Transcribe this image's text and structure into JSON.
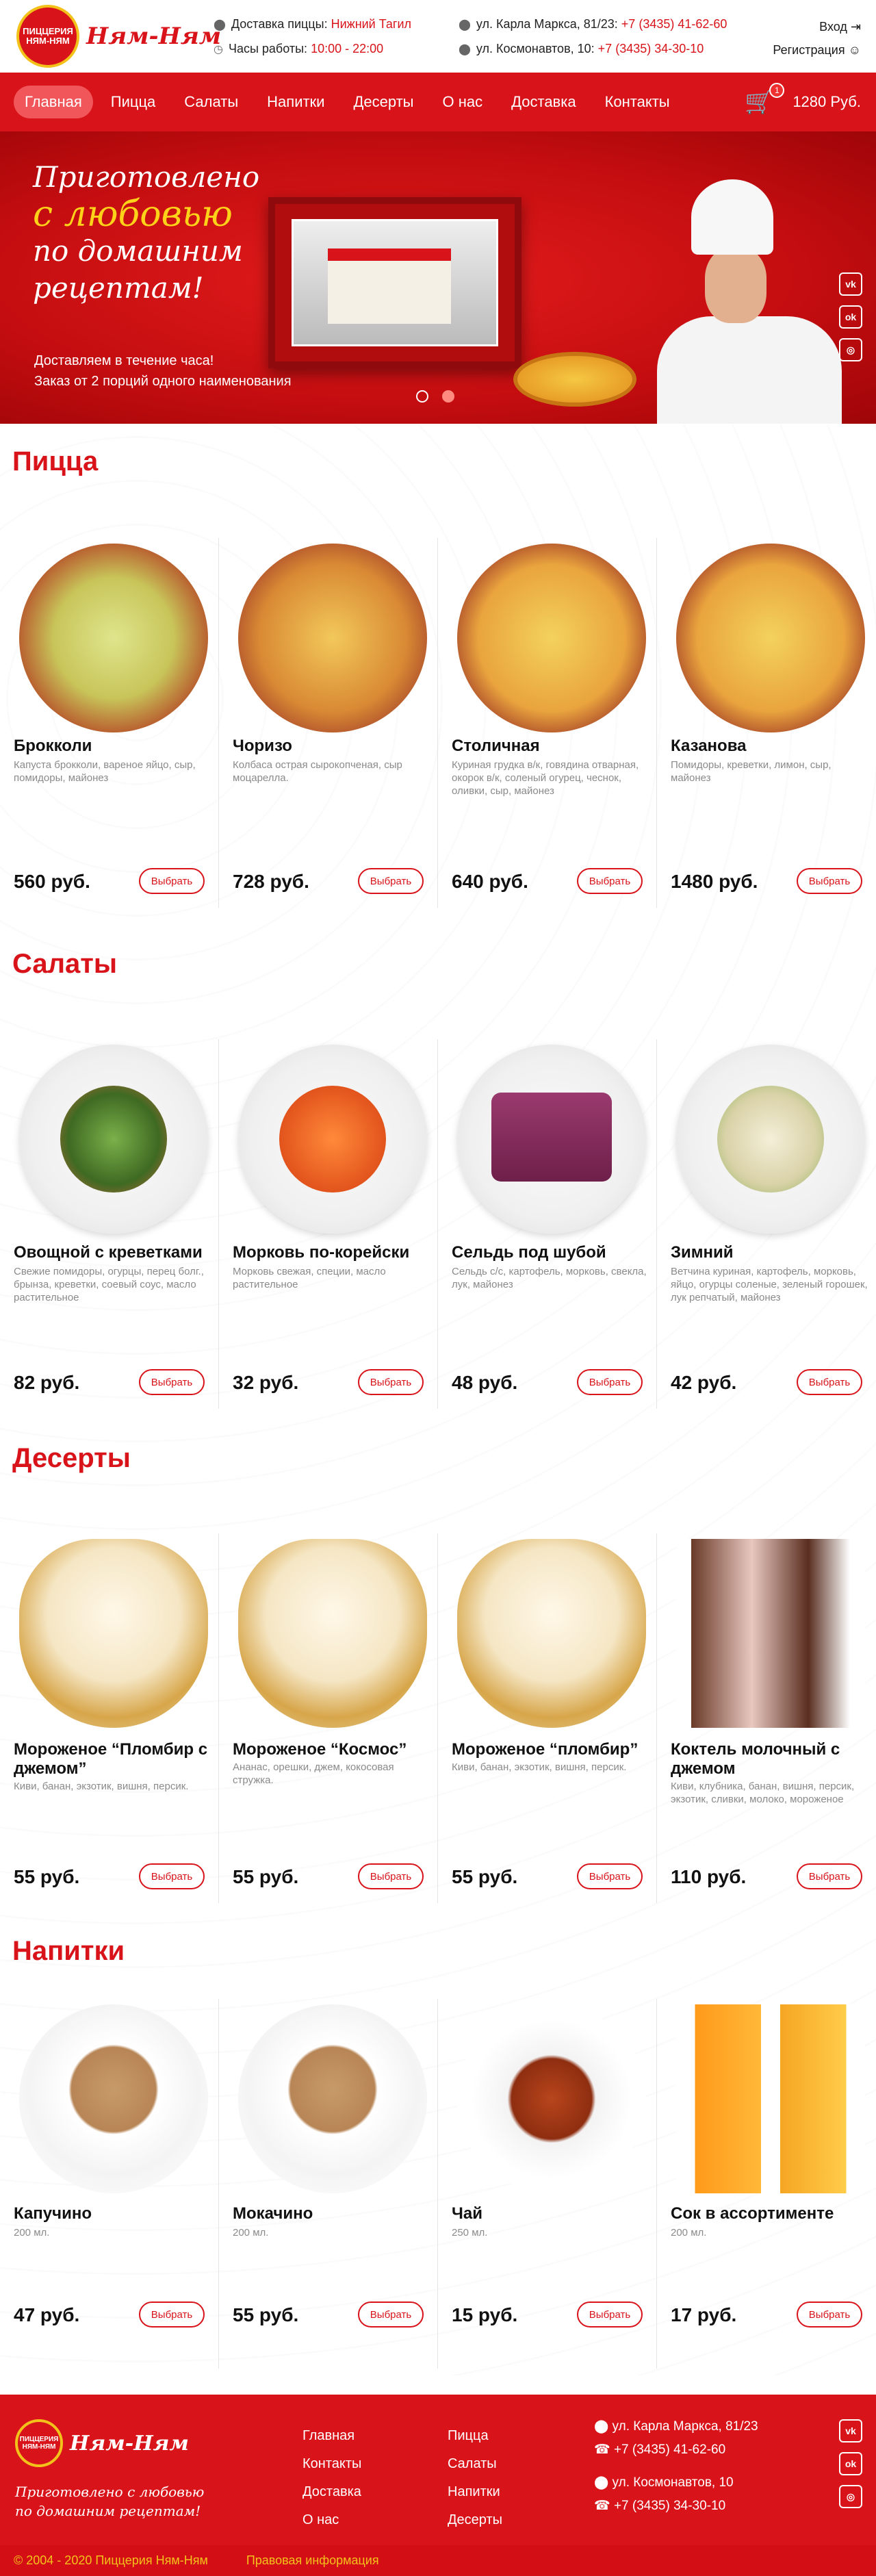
{
  "header": {
    "logo_text": "Ням-Ням",
    "logo_badge": "ПИЦЦЕРИЯ НЯМ-НЯМ",
    "delivery_label": "Доставка пиццы:",
    "delivery_city": "Нижний Тагил",
    "hours_label": "Часы работы:",
    "hours_value": "10:00 - 22:00",
    "address1": "ул. Карла Маркса, 81/23:",
    "phone1": "+7 (3435) 41-62-60",
    "address2": "ул. Космонавтов, 10:",
    "phone2": "+7 (3435) 34-30-10",
    "login": "Вход",
    "register": "Регистрация"
  },
  "nav": {
    "items": [
      "Главная",
      "Пицца",
      "Салаты",
      "Напитки",
      "Десерты",
      "О нас",
      "Доставка",
      "Контакты"
    ],
    "cart_count": "1",
    "cart_total": "1280 Руб."
  },
  "hero": {
    "line1": "Приготовлено",
    "line2": "с любовью",
    "line3": "по домашним",
    "line4": "рецептам!",
    "sub1": "Доставляем в течение часа!",
    "sub2": "Заказ от 2 порций одного наименования"
  },
  "social": [
    "vk-icon",
    "odnoklassniki-icon",
    "instagram-icon"
  ],
  "sections": {
    "pizza": {
      "title": "Пицца",
      "items": [
        {
          "name": "Брокколи",
          "desc": "Капуста брокколи, вареное яйцо, сыр, помидоры, майонез",
          "price": "560 руб.",
          "btn": "Выбрать"
        },
        {
          "name": "Чоризо",
          "desc": "Колбаса острая сырокопченая, сыр моцарелла.",
          "price": "728 руб.",
          "btn": "Выбрать"
        },
        {
          "name": "Столичная",
          "desc": "Куриная грудка в/к, говядина отварная, окорок в/к, соленый огурец, чеснок, оливки, сыр, майонез",
          "price": "640 руб.",
          "btn": "Выбрать"
        },
        {
          "name": "Казанова",
          "desc": "Помидоры, креветки, лимон, сыр, майонез",
          "price": "1480 руб.",
          "btn": "Выбрать"
        }
      ]
    },
    "salads": {
      "title": "Салаты",
      "items": [
        {
          "name": "Овощной с креветками",
          "desc": "Свежие помидоры, огурцы, перец болг., брынза, креветки, соевый соус, масло растительное",
          "price": "82 руб.",
          "btn": "Выбрать"
        },
        {
          "name": "Морковь по-корейски",
          "desc": "Морковь свежая, специи, масло растительное",
          "price": "32 руб.",
          "btn": "Выбрать"
        },
        {
          "name": "Сельдь под шубой",
          "desc": "Сельдь с/с, картофель, морковь, свекла, лук, майонез",
          "price": "48 руб.",
          "btn": "Выбрать"
        },
        {
          "name": "Зимний",
          "desc": "Ветчина куриная, картофель, морковь, яйцо, огурцы соленые, зеленый горошек, лук репчатый, майонез",
          "price": "42 руб.",
          "btn": "Выбрать"
        }
      ]
    },
    "desserts": {
      "title": "Десерты",
      "items": [
        {
          "name": "Мороженое “Пломбир с джемом”",
          "desc": "Киви, банан, экзотик, вишня, персик.",
          "price": "55 руб.",
          "btn": "Выбрать"
        },
        {
          "name": "Мороженое “Космос”",
          "desc": "Ананас, орешки, джем, кокосовая стружка.",
          "price": "55 руб.",
          "btn": "Выбрать"
        },
        {
          "name": "Мороженое “пломбир”",
          "desc": "Киви, банан, экзотик, вишня, персик.",
          "price": "55 руб.",
          "btn": "Выбрать"
        },
        {
          "name": "Коктель молочный с джемом",
          "desc": "Киви, клубника, банан, вишня, персик, экзотик, сливки, молоко, мороженое",
          "price": "110 руб.",
          "btn": "Выбрать"
        }
      ]
    },
    "drinks": {
      "title": "Напитки",
      "items": [
        {
          "name": "Капучино",
          "desc": "200 мл.",
          "price": "47 руб.",
          "btn": "Выбрать"
        },
        {
          "name": "Мокачино",
          "desc": "200 мл.",
          "price": "55 руб.",
          "btn": "Выбрать"
        },
        {
          "name": "Чай",
          "desc": "250 мл.",
          "price": "15 руб.",
          "btn": "Выбрать"
        },
        {
          "name": "Сок в ассортименте",
          "desc": "200 мл.",
          "price": "17 руб.",
          "btn": "Выбрать"
        }
      ]
    }
  },
  "footer": {
    "slogan": "Приготовлено с любовью по домашним рецептам!",
    "col1": [
      "Главная",
      "Контакты",
      "Доставка",
      "О нас"
    ],
    "col2": [
      "Пицца",
      "Салаты",
      "Напитки",
      "Десерты"
    ],
    "addr1": "ул. Карла Маркса, 81/23",
    "phone1": "+7 (3435) 41-62-60",
    "addr2": "ул. Космонавтов, 10",
    "phone2": "+7 (3435) 34-30-10",
    "copyright": "© 2004 - 2020 Пиццерия Ням-Ням",
    "legal": "Правовая информация"
  }
}
